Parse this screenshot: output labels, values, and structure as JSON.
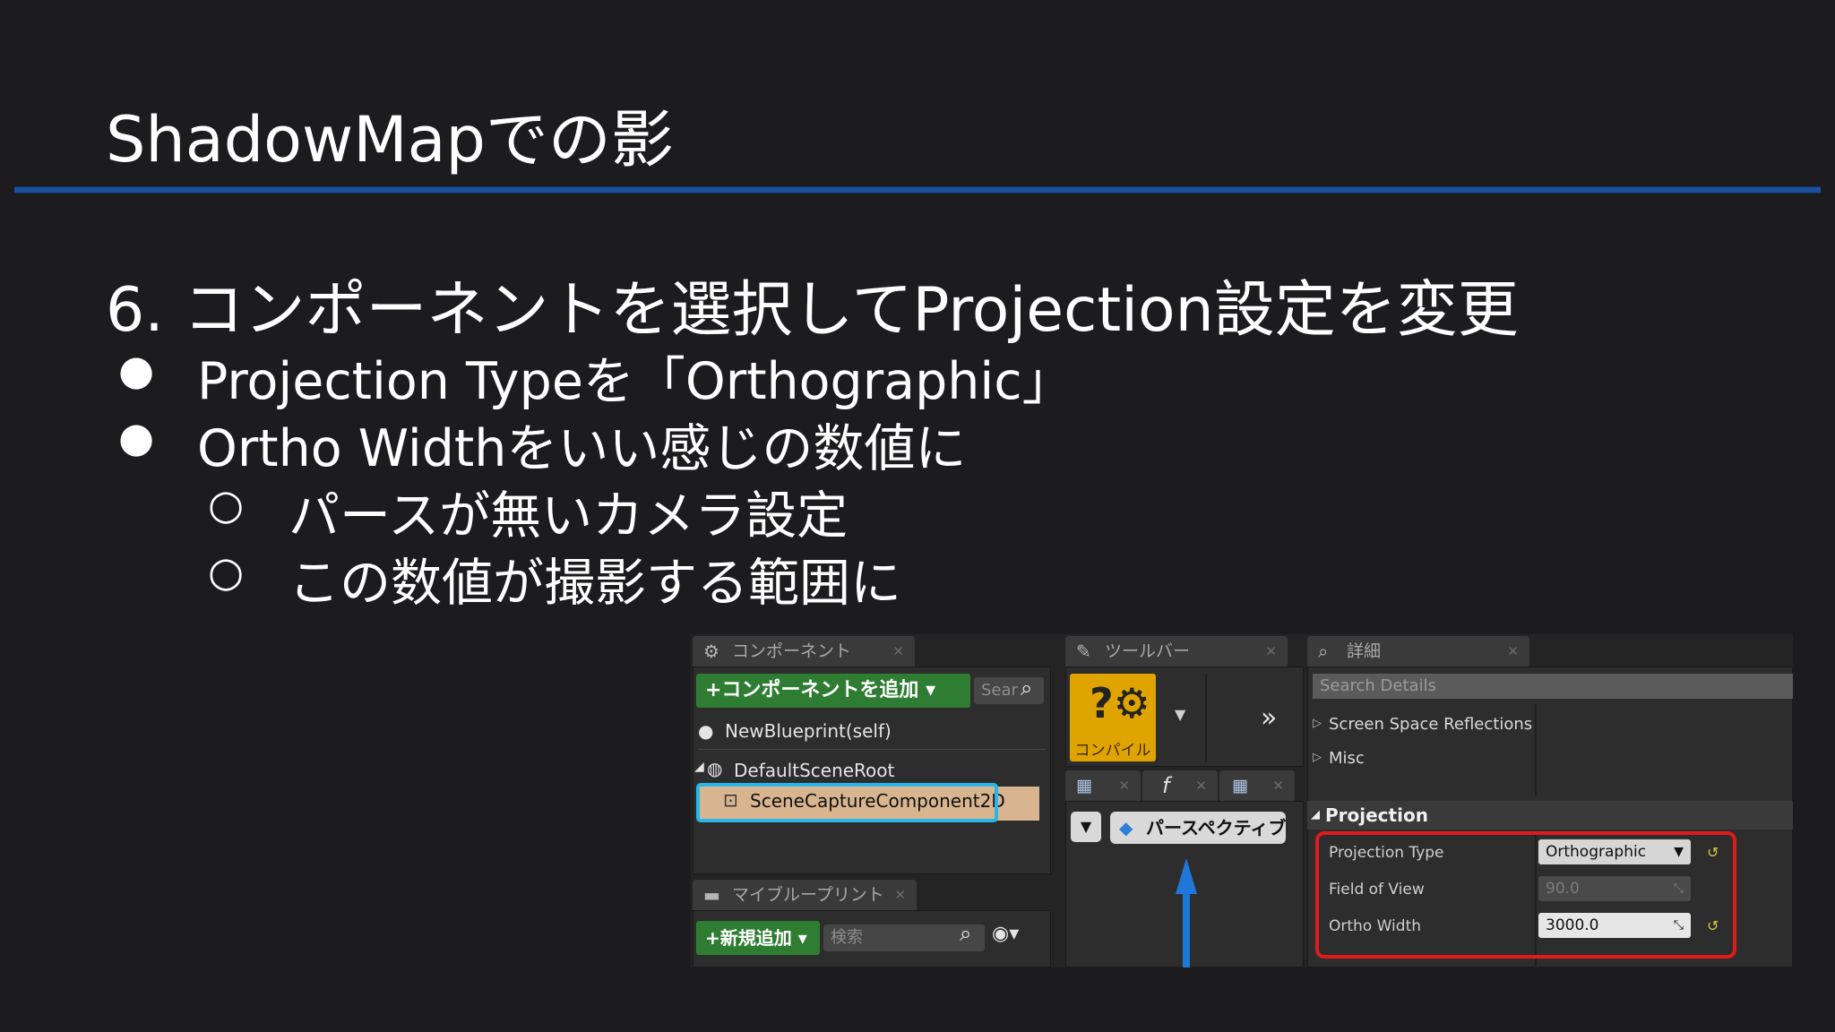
{
  "slide": {
    "title": "ShadowMapでの影",
    "heading": "6. コンポーネントを選択してProjection設定を変更",
    "bullets": [
      "Projection Typeを「Orthographic」",
      "Ortho Widthをいい感じの数値に"
    ],
    "sub_bullets": [
      "パースが無いカメラ設定",
      "この数値が撮影する範囲に"
    ],
    "bullet_mark": "●",
    "sub_bullet_mark": "○"
  },
  "editor": {
    "components_tab": "コンポーネント",
    "add_component_label": "+コンポーネントを追加 ▾",
    "components_search_placeholder": "Sear",
    "tree": {
      "self": "NewBlueprint(self)",
      "root": "DefaultSceneRoot",
      "selected": "SceneCaptureComponent2D"
    },
    "my_blueprint_tab": "マイブループリント",
    "new_add_label": "+新規追加 ▾",
    "blueprint_search_placeholder": "検索",
    "toolbar_tab": "ツールバー",
    "compile_label": "コンパイル",
    "perspective_label": "パースペクティブ",
    "details_tab": "詳細",
    "details_search_placeholder": "Search Details",
    "categories": [
      "Screen Space Reflections",
      "Misc"
    ],
    "projection_header": "Projection",
    "properties": [
      {
        "label": "Projection Type",
        "value": "Orthographic",
        "enabled": true
      },
      {
        "label": "Field of View",
        "value": "90.0",
        "enabled": false
      },
      {
        "label": "Ortho Width",
        "value": "3000.0",
        "enabled": true
      }
    ],
    "icons": {
      "components": "gear-icon",
      "toolbar": "wrench-icon",
      "details": "magnifier-icon",
      "compile": "question-gear-icon",
      "overflow": "double-chevron-right-icon",
      "perspective": "diamond-icon",
      "visibility": "eye-icon",
      "reset": "reset-arrow-icon"
    },
    "accent_colors": {
      "add_button": "#2f7d32",
      "selection_highlight": "#29b6e8",
      "compile_button": "#e0a400",
      "annotation": "#e01a1a",
      "title_rule": "#1d4f9a"
    }
  }
}
